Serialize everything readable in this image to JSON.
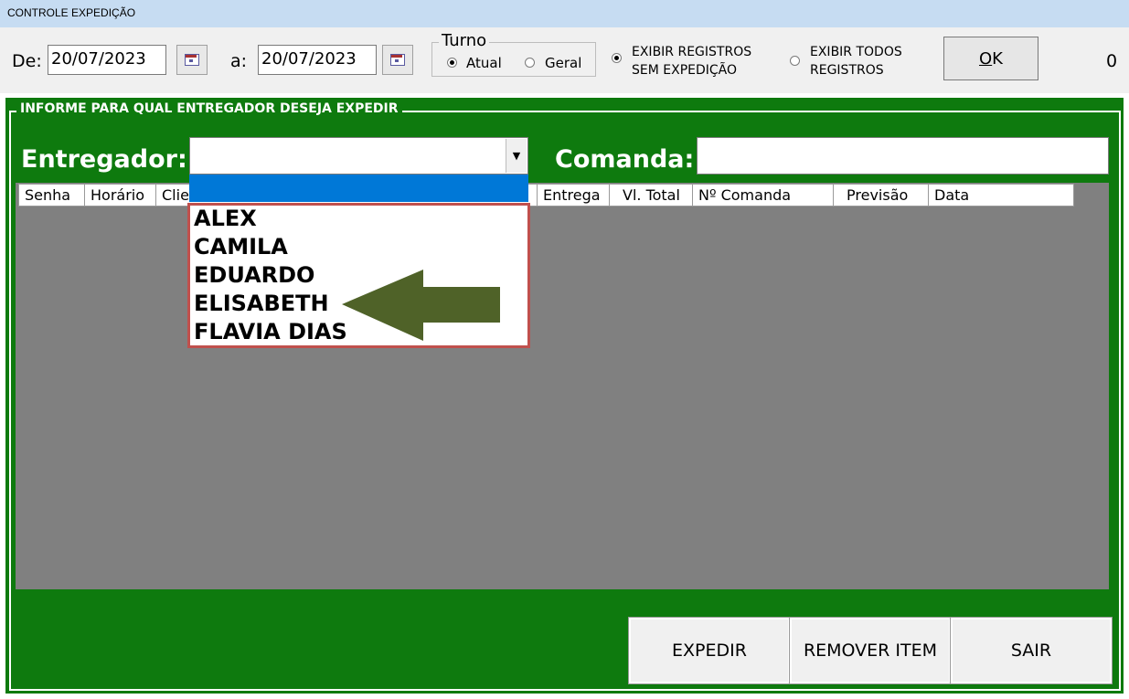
{
  "window": {
    "title": "CONTROLE EXPEDIÇÃO"
  },
  "toolbar": {
    "from_label": "De:",
    "from_date": "20/07/2023",
    "to_label": "a:",
    "to_date": "20/07/2023",
    "turno": {
      "legend": "Turno",
      "options": [
        "Atual",
        "Geral"
      ],
      "selected": "Atual"
    },
    "filter": {
      "option1_line1": "EXIBIR REGISTROS",
      "option1_line2": "SEM EXPEDIÇÃO",
      "option2_line1": "EXIBIR TODOS",
      "option2_line2": "REGISTROS",
      "selected": "option1"
    },
    "ok_mnemonic": "O",
    "ok_rest": "K",
    "count": "0"
  },
  "panel": {
    "title": "INFORME PARA QUAL ENTREGADOR DESEJA EXPEDIR",
    "entregador_label": "Entregador:",
    "comanda_label": "Comanda:"
  },
  "grid": {
    "columns": [
      "Senha",
      "Horário",
      "Clie",
      "Entrega",
      "Vl. Total",
      "Nº Comanda",
      "Previsão",
      "Data"
    ]
  },
  "dropdown": {
    "items": [
      "ALEX",
      "CAMILA",
      "EDUARDO",
      "ELISABETH",
      "FLAVIA DIAS"
    ],
    "annotation_color": "#c0504d",
    "arrow_color": "#4f6228"
  },
  "buttons": {
    "expedir": "EXPEDIR",
    "remover": "REMOVER ITEM",
    "sair": "SAIR"
  },
  "colors": {
    "panel_green": "#0e7a0e",
    "grid_gray": "#808080",
    "selection_blue": "#0078d7"
  }
}
